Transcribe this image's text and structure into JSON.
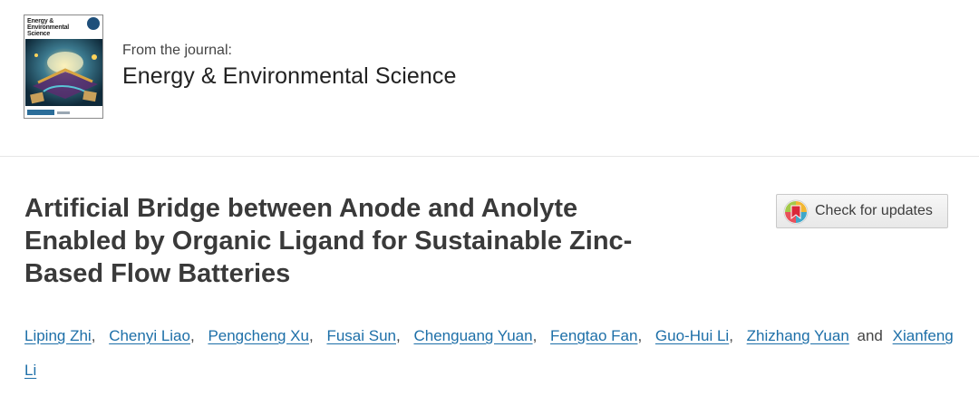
{
  "journal": {
    "cover_title": "Energy & Environmental Science",
    "from_label": "From the journal:",
    "name": "Energy & Environmental Science"
  },
  "article": {
    "title_lines": [
      "Artificial Bridge between Anode and Anolyte",
      "Enabled by Organic Ligand for Sustainable Zinc-",
      "Based Flow Batteries"
    ]
  },
  "updates_button": {
    "label": "Check for updates"
  },
  "authors": {
    "names": [
      "Liping Zhi",
      "Chenyi Liao",
      "Pengcheng Xu",
      "Fusai Sun",
      "Chenguang Yuan",
      "Fengtao Fan",
      "Guo-Hui Li",
      "Zhizhang Yuan"
    ],
    "last_author_first_line": "Xianfeng",
    "last_author_second_line": "Li",
    "conjunction": "and",
    "separator": ","
  },
  "colors": {
    "link": "#1d6fa8",
    "title": "#3a3a3a",
    "divider": "#e6e6e6"
  }
}
